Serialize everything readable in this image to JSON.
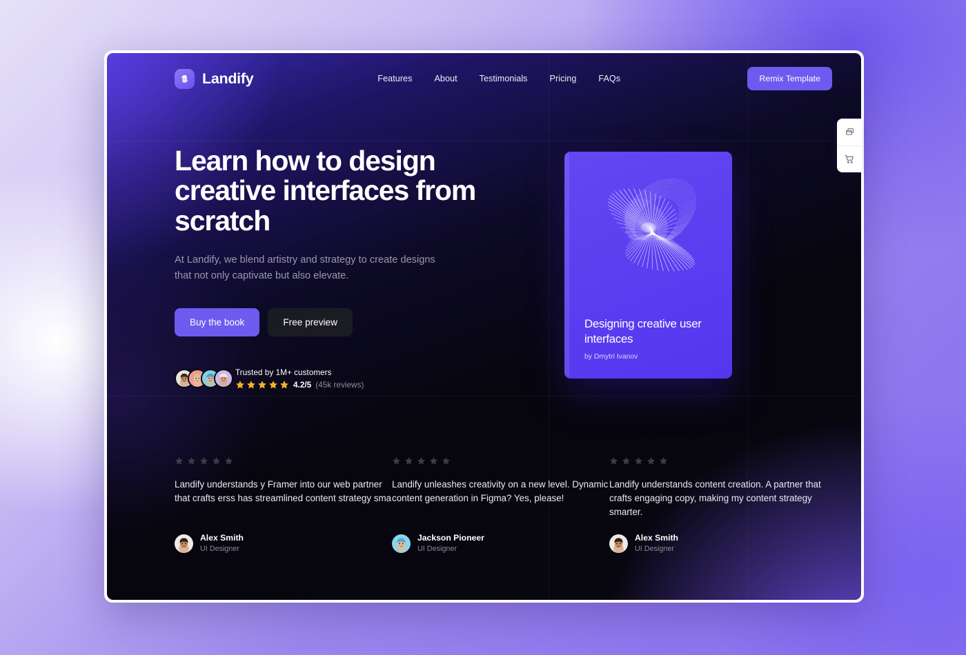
{
  "navbar": {
    "brand": {
      "name": "Landify",
      "logo_icon": "landify-logo-icon"
    },
    "links": [
      {
        "label": "Features"
      },
      {
        "label": "About"
      },
      {
        "label": "Testimonials"
      },
      {
        "label": "Pricing"
      },
      {
        "label": "FAQs"
      }
    ],
    "cta": {
      "label": "Remix Template"
    }
  },
  "hero": {
    "headline": "Learn how to design creative interfaces from scratch",
    "subheadline": "At Landify, we blend artistry and strategy to create designs that not only captivate but also elevate.",
    "primary_button": "Buy the book",
    "secondary_button": "Free preview",
    "social_proof": {
      "trust_text": "Trusted by 1M+ customers",
      "score": "4.2/5",
      "reviews": "(45k reviews)",
      "stars": 5,
      "avatars": [
        {
          "name": "customer-avatar-1",
          "bg": "#e7e4df",
          "skin": "#c98c62",
          "hair": "#3a2a20"
        },
        {
          "name": "customer-avatar-2",
          "bg": "#f09a90",
          "skin": "#e8c4a0",
          "hair": "#d8c089"
        },
        {
          "name": "customer-avatar-3",
          "bg": "#7fd2e8",
          "skin": "#e0b894",
          "hair": "#4a9fd0"
        },
        {
          "name": "customer-avatar-4",
          "bg": "#cfb8ec",
          "skin": "#d8a378",
          "hair": "#efe7de"
        }
      ]
    }
  },
  "book_card": {
    "title": "Designing creative user interfaces",
    "author": "by Dmytri Ivanov",
    "cover_art": "mobius-wireframe-illustration",
    "background_color": "#5b3ff0"
  },
  "testimonials": [
    {
      "stars": 5,
      "quote": "Landify understands y Framer into our web partner that crafts erss has streamlined content strategy sma",
      "author": "Alex Smith",
      "role": "UI Designer",
      "avatar": {
        "name": "alex-smith-avatar",
        "bg": "#efeae4",
        "skin": "#c9875c",
        "hair": "#2e2118"
      }
    },
    {
      "stars": 5,
      "quote": "Landify unleashes creativity on a new level. Dynamic content generation in Figma? Yes, please!",
      "author": "Jackson Pioneer",
      "role": "UI Designer",
      "avatar": {
        "name": "jackson-pioneer-avatar",
        "bg": "#8ad6ea",
        "skin": "#e3bc96",
        "hair": "#57a8d4"
      }
    },
    {
      "stars": 5,
      "quote": "Landify understands content creation. A partner that crafts engaging copy, making my content strategy smarter.",
      "author": "Alex Smith",
      "role": "UI Designer",
      "avatar": {
        "name": "alex-smith-avatar",
        "bg": "#efeae4",
        "skin": "#c9875c",
        "hair": "#2e2118"
      }
    }
  ],
  "side_toolbar": {
    "buttons": [
      {
        "name": "duplicate-windows-icon",
        "tooltip": "Layers"
      },
      {
        "name": "shopping-cart-icon",
        "tooltip": "Cart"
      }
    ]
  },
  "theme": {
    "accent": "#6d5bf0",
    "star_gold": "#f5b128",
    "star_muted": "#3c3c47",
    "canvas_dark": "#08060f",
    "text_primary": "#ffffff",
    "text_muted": "#8d8a9c"
  }
}
